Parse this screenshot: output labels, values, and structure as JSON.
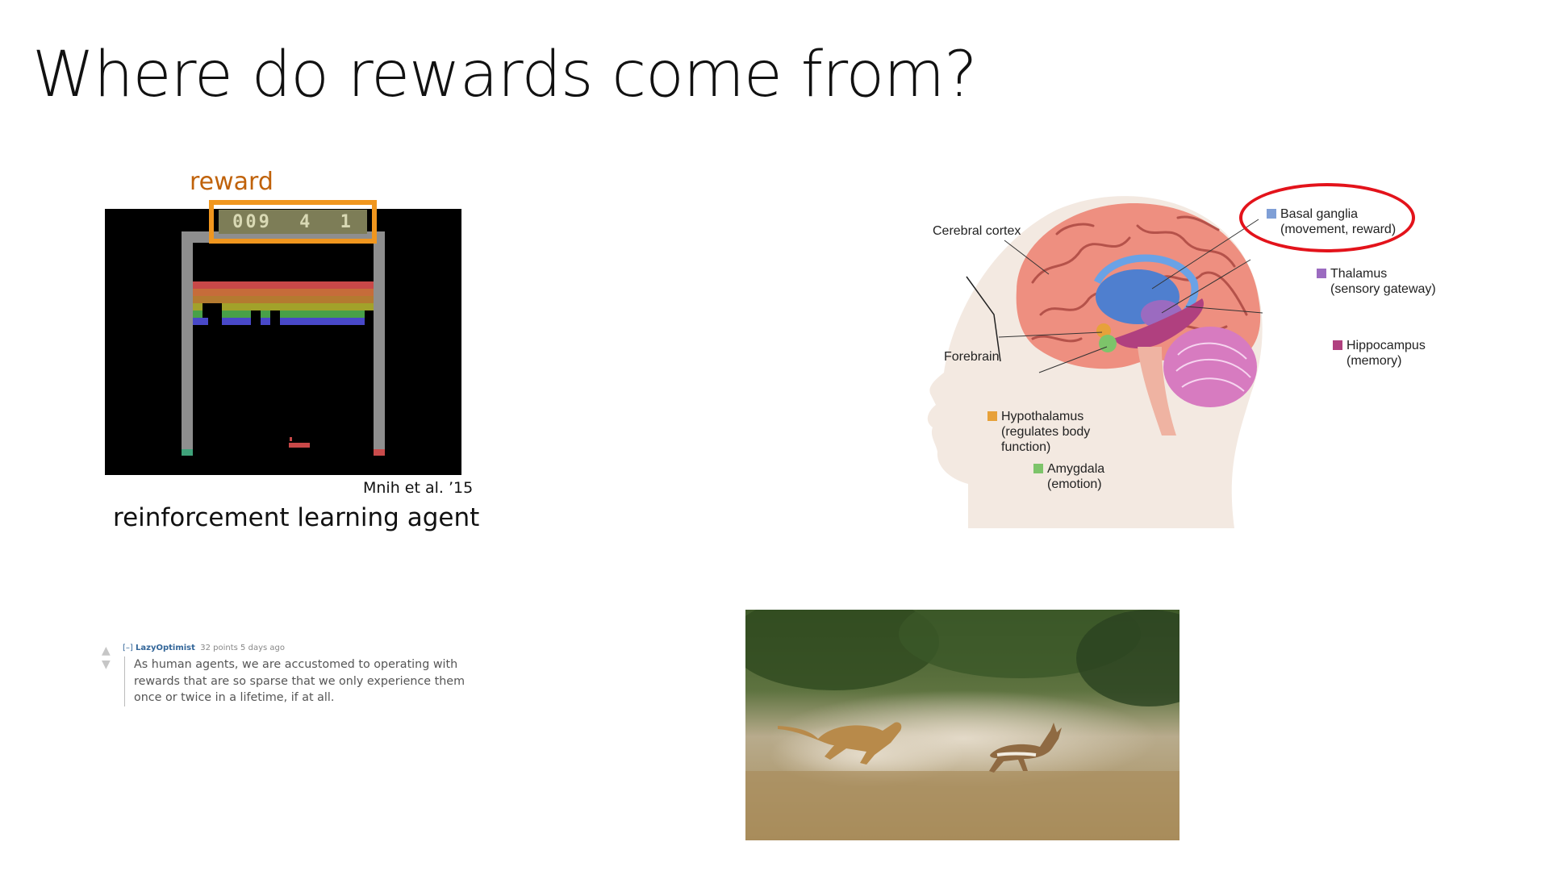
{
  "slide": {
    "title": "Where do rewards come from?"
  },
  "breakout": {
    "reward_label": "reward",
    "score_digits": [
      "009",
      "4",
      "1"
    ],
    "citation": "Mnih et al. ’15",
    "caption": "reinforcement learning agent"
  },
  "brain": {
    "labels": {
      "cerebral_cortex": "Cerebral cortex",
      "forebrain": "Forebrain",
      "basal_ganglia": "Basal ganglia",
      "basal_ganglia_note": "(movement, reward)",
      "thalamus": "Thalamus",
      "thalamus_note": "(sensory gateway)",
      "hippocampus": "Hippocampus",
      "hippocampus_note": "(memory)",
      "hypothalamus": "Hypothalamus",
      "hypothalamus_note1": "(regulates body",
      "hypothalamus_note2": "function)",
      "amygdala": "Amygdala",
      "amygdala_note": "(emotion)"
    },
    "colors": {
      "basal_ganglia": "#7f9fd6",
      "thalamus": "#9b6bc0",
      "hippocampus": "#b0407f",
      "hypothalamus": "#e7a13a",
      "amygdala": "#7dc46a",
      "highlight": "#e3131b"
    }
  },
  "comment": {
    "toggle": "[–]",
    "username": "LazyOptimist",
    "meta": "32 points 5 days ago",
    "body": "As human agents, we are accustomed to operating with rewards that are so sparse that we only experience them once or twice in a lifetime, if at all."
  }
}
